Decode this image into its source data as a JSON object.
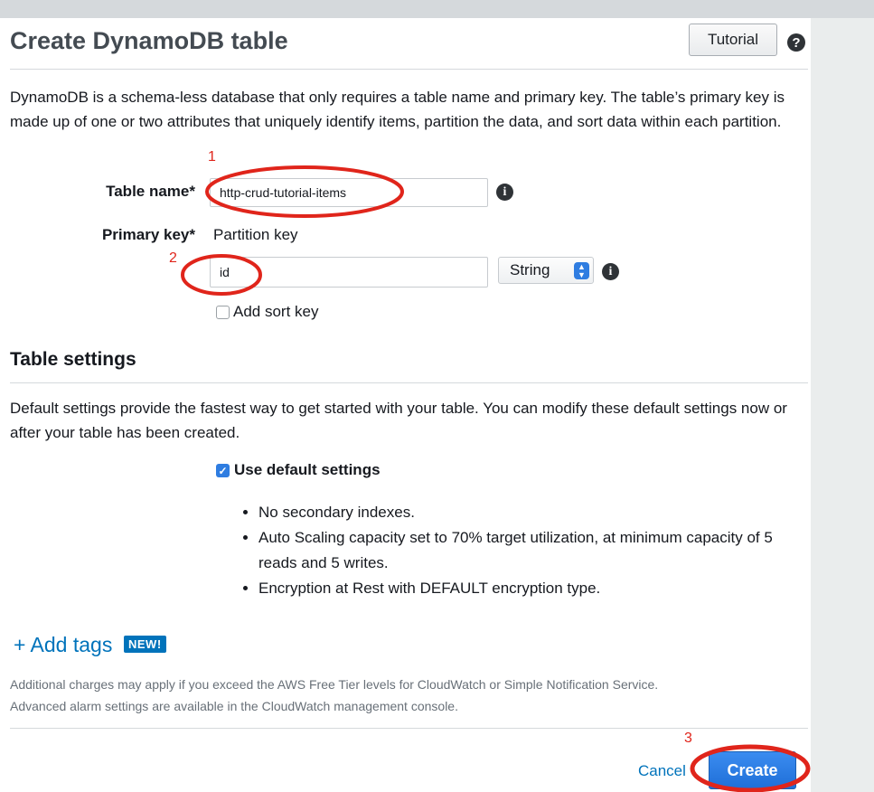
{
  "header": {
    "title": "Create DynamoDB table",
    "tutorial_label": "Tutorial",
    "help_icon": "?"
  },
  "intro_text": "DynamoDB is a schema-less database that only requires a table name and primary key. The table’s primary key is made up of one or two attributes that uniquely identify items, partition the data, and sort data within each partition.",
  "form": {
    "table_name_label": "Table name*",
    "table_name_value": "http-crud-tutorial-items",
    "primary_key_label": "Primary key*",
    "partition_key_label": "Partition key",
    "partition_key_value": "id",
    "key_type_selected": "String",
    "sort_key_label": "Add sort key",
    "sort_key_checked": false,
    "info_icon": "i"
  },
  "settings": {
    "title": "Table settings",
    "description": "Default settings provide the fastest way to get started with your table. You can modify these default settings now or after your table has been created.",
    "use_default_label": "Use default settings",
    "use_default_checked": true,
    "bullets": [
      "No secondary indexes.",
      "Auto Scaling capacity set to 70% target utilization, at minimum capacity of 5 reads and 5 writes.",
      "Encryption at Rest with DEFAULT encryption type."
    ]
  },
  "tags": {
    "add_label": "+ Add tags",
    "badge": "NEW!"
  },
  "footer_note": {
    "line1": "Additional charges may apply if you exceed the AWS Free Tier levels for CloudWatch or Simple Notification Service.",
    "line2": "Advanced alarm settings are available in the CloudWatch management console."
  },
  "actions": {
    "cancel_label": "Cancel",
    "create_label": "Create"
  },
  "annotations": {
    "marker_color": "#e0251b",
    "numbers": [
      "1",
      "2",
      "3"
    ]
  },
  "colors": {
    "link": "#0073bb",
    "primary_button": "#1f6fd8",
    "annotation": "#e0251b"
  }
}
